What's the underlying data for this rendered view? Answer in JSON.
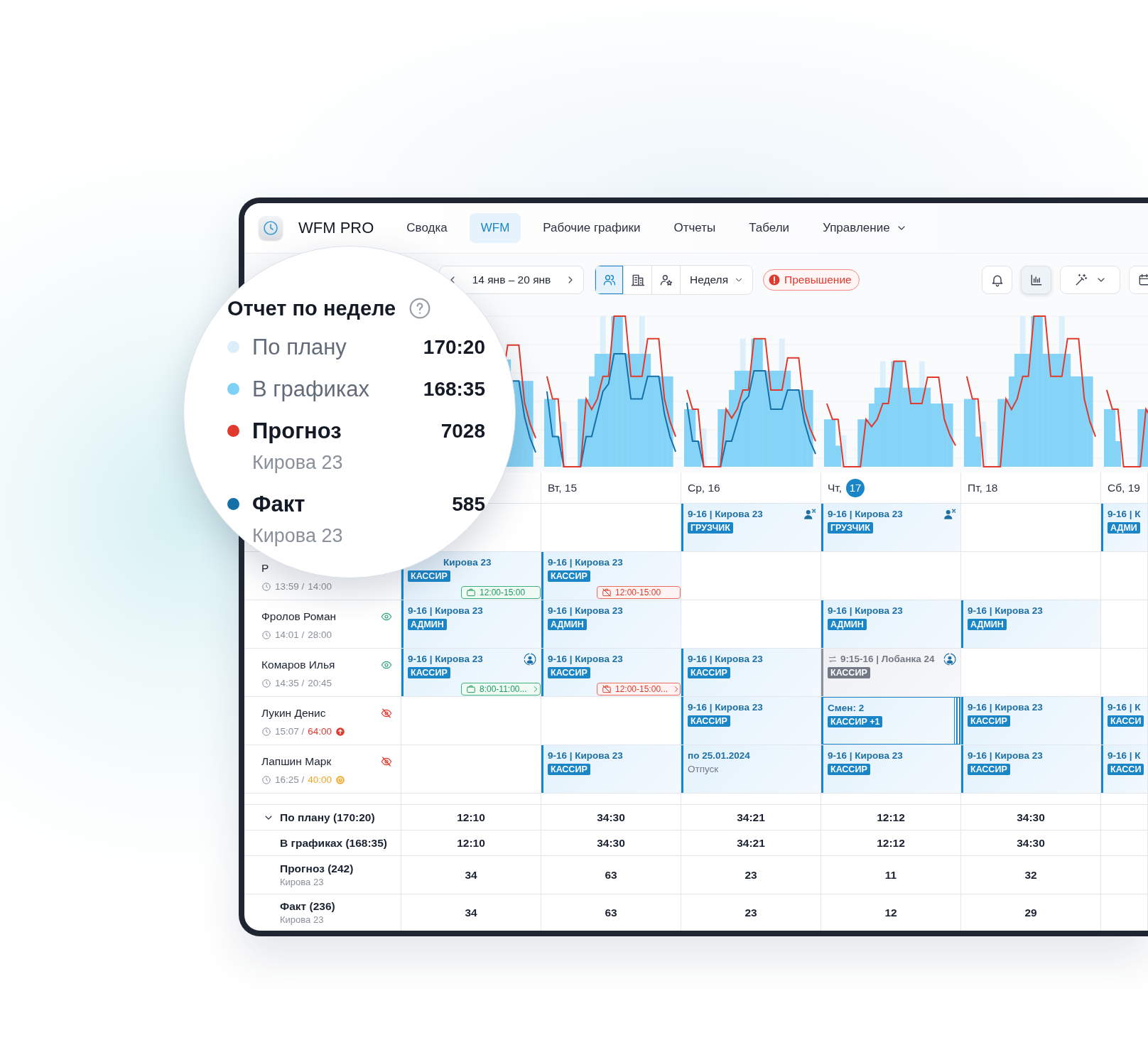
{
  "nav": {
    "app_name": "WFM PRO",
    "tabs": [
      {
        "label": "Сводка",
        "selected": false,
        "kind": "link"
      },
      {
        "label": "WFM",
        "selected": true,
        "kind": "link"
      },
      {
        "label": "Рабочие графики",
        "selected": false,
        "kind": "link"
      },
      {
        "label": "Отчеты",
        "selected": false,
        "kind": "link"
      },
      {
        "label": "Табели",
        "selected": false,
        "kind": "link"
      },
      {
        "label": "Управление",
        "selected": false,
        "kind": "menu"
      }
    ]
  },
  "toolbar": {
    "date_range": "14 янв – 20 янв",
    "views": [
      {
        "kind": "people",
        "selected": true
      },
      {
        "kind": "building",
        "selected": false
      },
      {
        "kind": "person-star",
        "selected": false
      }
    ],
    "period": "Неделя",
    "alert": "Превышение",
    "actions": [
      {
        "kind": "bell",
        "selected": false
      },
      {
        "kind": "chart",
        "selected": true
      },
      {
        "kind": "wand",
        "selected": false
      },
      {
        "kind": "calendar",
        "selected": false
      }
    ]
  },
  "days": [
    {
      "label": "Вт, 15"
    },
    {
      "label": "Ср, 16"
    },
    {
      "label": "Чт,",
      "badge": "17"
    },
    {
      "label": "Пт, 18"
    },
    {
      "label": "Сб, 19"
    }
  ],
  "employees": [
    {
      "cells": [
        {
          "kind": "empty"
        },
        {
          "kind": "empty"
        },
        {
          "kind": "shift",
          "title": "9-16 | Кирова 23",
          "role": "ГРУЗЧИК",
          "marker": {
            "kind": "person-remove"
          }
        },
        {
          "kind": "shift",
          "title": "9-16 | Кирова 23",
          "role": "ГРУЗЧИК",
          "marker": {
            "kind": "person-remove"
          }
        },
        {
          "kind": "empty"
        },
        {
          "kind": "shift",
          "title": "9-16 | К",
          "role": "АДМИ"
        }
      ]
    },
    {
      "name": "Р",
      "time": "13:59 /",
      "hours": {
        "text": "14:00",
        "kind": "normal"
      },
      "cells": [
        {
          "kind": "partial",
          "title": "Кирова 23",
          "role": "КАССИР",
          "tag": {
            "kind": "ok",
            "text": "12:00-15:00",
            "more": false
          }
        },
        {
          "kind": "shift",
          "title": "9-16 | Кирова 23",
          "role": "КАССИР",
          "tag": {
            "kind": "missed",
            "text": "12:00-15:00",
            "more": false
          }
        },
        {
          "kind": "empty"
        },
        {
          "kind": "empty"
        },
        {
          "kind": "empty"
        },
        {
          "kind": "empty"
        }
      ]
    },
    {
      "name": "Фролов Роман",
      "visible": true,
      "time": "14:01 /",
      "hours": {
        "text": "28:00",
        "kind": "normal"
      },
      "cells": [
        {
          "kind": "shift",
          "title": "9-16 | Кирова 23",
          "role": "АДМИН"
        },
        {
          "kind": "shift",
          "title": "9-16 | Кирова 23",
          "role": "АДМИН"
        },
        {
          "kind": "empty"
        },
        {
          "kind": "shift",
          "title": "9-16 | Кирова 23",
          "role": "АДМИН"
        },
        {
          "kind": "shift",
          "title": "9-16 | Кирова 23",
          "role": "АДМИН"
        },
        {
          "kind": "empty"
        }
      ]
    },
    {
      "name": "Комаров Илья",
      "visible": true,
      "time": "14:35 /",
      "hours": {
        "text": "20:45",
        "kind": "normal"
      },
      "cells": [
        {
          "kind": "shift",
          "title": "9-16 | Кирова 23",
          "role": "КАССИР",
          "marker": {
            "kind": "swap"
          },
          "tag": {
            "kind": "ok",
            "text": "8:00-11:00...",
            "more": true
          }
        },
        {
          "kind": "shift",
          "title": "9-16 | Кирова 23",
          "role": "КАССИР",
          "tag": {
            "kind": "missed",
            "text": "12:00-15:00...",
            "more": true
          }
        },
        {
          "kind": "shift",
          "title": "9-16 | Кирова 23",
          "role": "КАССИР"
        },
        {
          "kind": "transfer",
          "title": "9:15-16 | Лобанка 24",
          "role": "КАССИР",
          "marker": {
            "kind": "swap"
          }
        },
        {
          "kind": "empty"
        },
        {
          "kind": "empty"
        }
      ]
    },
    {
      "name": "Лукин Денис",
      "visible": false,
      "time": "15:07 /",
      "hours": {
        "text": "64:00",
        "kind": "over"
      },
      "cells": [
        {
          "kind": "empty"
        },
        {
          "kind": "empty"
        },
        {
          "kind": "shift",
          "title": "9-16 | Кирова 23",
          "role": "КАССИР"
        },
        {
          "kind": "multi",
          "title": "Смен: 2",
          "role": "КАССИР +1"
        },
        {
          "kind": "shift",
          "title": "9-16 | Кирова 23",
          "role": "КАССИР"
        },
        {
          "kind": "shift",
          "title": "9-16 | К",
          "role": "КАССИ"
        }
      ]
    },
    {
      "name": "Лапшин Марк",
      "visible": false,
      "time": "16:25 /",
      "hours": {
        "text": "40:00",
        "kind": "warn"
      },
      "cells": [
        {
          "kind": "empty"
        },
        {
          "kind": "shift",
          "title": "9-16 | Кирова 23",
          "role": "КАССИР"
        },
        {
          "kind": "absence",
          "title": "по 25.01.2024",
          "note": "Отпуск"
        },
        {
          "kind": "shift",
          "title": "9-16 | Кирова 23",
          "role": "КАССИР"
        },
        {
          "kind": "shift",
          "title": "9-16 | Кирова 23",
          "role": "КАССИР"
        },
        {
          "kind": "shift",
          "title": "9-16 | К",
          "role": "КАССИ"
        }
      ]
    }
  ],
  "summary": [
    {
      "kind": "group",
      "expanded": true,
      "label": "По плану (170:20)",
      "values": [
        "12:10",
        "34:30",
        "34:21",
        "12:12",
        "34:30"
      ]
    },
    {
      "kind": "line",
      "label": "В графиках (168:35)",
      "values": [
        "12:10",
        "34:30",
        "34:21",
        "12:12",
        "34:30"
      ]
    },
    {
      "kind": "line",
      "label": "Прогноз (242)",
      "sub": "Кирова 23",
      "values": [
        "34",
        "63",
        "23",
        "11",
        "32"
      ]
    },
    {
      "kind": "line",
      "label": "Факт (236)",
      "sub": "Кирова 23",
      "values": [
        "34",
        "63",
        "23",
        "12",
        "29"
      ]
    }
  ],
  "week_report": {
    "title": "Отчет по неделе",
    "items": [
      {
        "label": "По плану",
        "value": "170:20",
        "color": "#ddeefb",
        "strong": false
      },
      {
        "label": "В графиках",
        "value": "168:35",
        "color": "#7fd0f7",
        "strong": false
      },
      {
        "label": "Прогноз",
        "sub": "Кирова 23",
        "value": "7028",
        "color": "#e0392d",
        "strong": true
      },
      {
        "label": "Факт",
        "sub": "Кирова 23",
        "value": "585",
        "color": "#1670a8",
        "strong": true
      }
    ]
  }
}
